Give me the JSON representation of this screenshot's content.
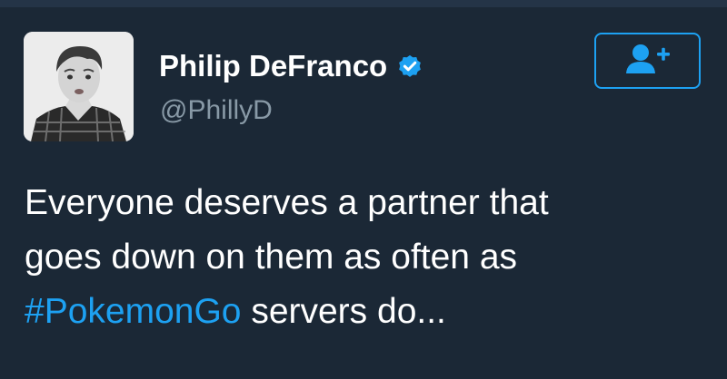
{
  "tweet": {
    "author": {
      "display_name": "Philip DeFranco",
      "handle": "@PhillyD",
      "verified": true
    },
    "text_line1": "Everyone deserves a partner that",
    "text_line2": "goes down on them as often as",
    "hashtag": "#PokemonGo",
    "text_tail": " servers do..."
  },
  "icons": {
    "verified": "verified-badge-icon",
    "follow": "follow-user-plus-icon"
  },
  "colors": {
    "background": "#1b2836",
    "link": "#1da1f2",
    "secondary_text": "#8899a6",
    "primary_text": "#ffffff"
  }
}
